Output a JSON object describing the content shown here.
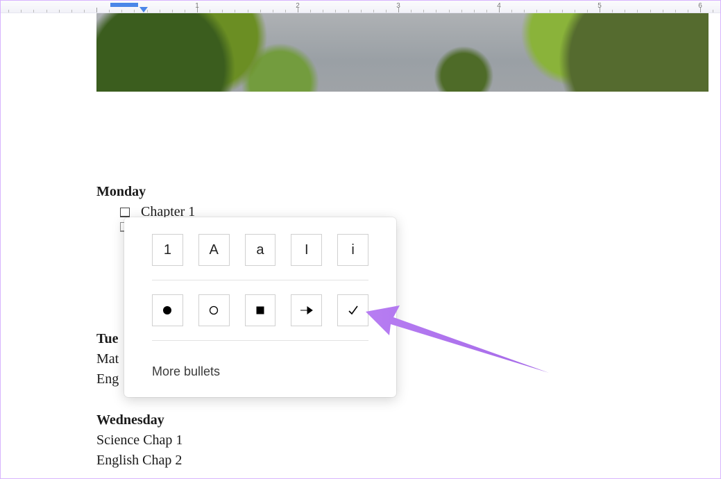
{
  "ruler": {
    "numbers": [
      "1",
      "2",
      "3",
      "4",
      "5",
      "6"
    ]
  },
  "doc": {
    "days": [
      {
        "name": "Monday",
        "checklist": [
          "Chapter 1"
        ]
      },
      {
        "name": "Tue",
        "lines": [
          "Mat",
          "Eng"
        ]
      },
      {
        "name": "Wednesday",
        "lines": [
          "Science Chap 1",
          "English Chap 2"
        ]
      }
    ]
  },
  "popup": {
    "row1": [
      "1",
      "A",
      "a",
      "I",
      "i"
    ],
    "row2_icons": [
      "disc",
      "circle",
      "square",
      "arrow",
      "check"
    ],
    "more_label": "More bullets"
  }
}
